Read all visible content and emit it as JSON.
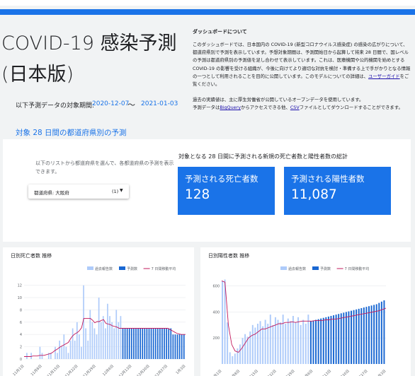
{
  "header": {
    "title": "COVID-19 感染予測 (日本版)",
    "period_label": "以下予測データの対象期間:",
    "period_start": "2020-12-07",
    "period_separator": "〜",
    "period_end": "2021-01-03"
  },
  "about": {
    "title": "ダッシュボードについて",
    "paragraph1_pre": "このダッシュボードでは、日本国内の COVID-19 (新型コロナウイルス感染症) の感染の広がりについて、都道府県別で予測を表示しています。予想対象期間は、予測開始日から起算して将来 28 日間で、国レベルの予測は都道府県別の予測値を足し合わせて表示しています。これは、医療機関や公的機関を始めとする COVID-19 の影響を受ける組織が、今後に向けてより適切な対抗を検討・準備する上で手がかりとなる情報の一つとして利用されることを目的に公開しています。このモデルについての詳細は、",
    "user_guide_link": "ユーザーガイド",
    "paragraph1_post": "をご覧ください。",
    "paragraph2_line1": "過去の実績値は、主に厚生労働省が公開しているオープンデータを使用しています。",
    "paragraph2_pre": "予測データは",
    "bigquery_link": "BigQuery",
    "paragraph2_mid": "からアクセスできる他、",
    "csv_link": "CSV",
    "paragraph2_post": "ファイルとしてダウンロードすることができます。"
  },
  "section": {
    "heading": "対象 28 日間の都道府県別の予測"
  },
  "selector": {
    "help_text": "以下のリストから都道府県を選んで、各都道府県の予測を表示できます。",
    "dropdown_label": "都道府県: 大阪府",
    "dropdown_count": "(1)"
  },
  "summary": {
    "heading": "対象となる 28 日間に予測される新規の死亡者数と陽性者数の総計",
    "deaths_label": "予測される死亡者数",
    "deaths_value": "128",
    "positives_label": "予測される陽性者数",
    "positives_value": "11,087"
  },
  "colors": {
    "accent": "#1a73e8",
    "reported_bar": "#aecbfa",
    "forecast_bar": "#1967d2",
    "moving_avg": "#c2185b"
  },
  "chart_data": [
    {
      "type": "bar",
      "title": "日別死亡者数 推移",
      "legend": [
        "過去報告数",
        "予測数",
        "7 日間移動平均"
      ],
      "y_ticks": [
        "0",
        "2",
        "4",
        "6",
        "8",
        "10",
        "12"
      ],
      "ylim": [
        0,
        13
      ],
      "x_labels": [
        "11月1日",
        "11月8日",
        "11月15日",
        "11月22日",
        "11月29日",
        "12月6日",
        "12月13日",
        "12月20日",
        "12月27日",
        "1月3日"
      ],
      "series": [
        {
          "name": "過去報告数",
          "values": [
            0,
            1,
            0,
            1,
            0,
            0,
            0,
            2,
            1,
            0,
            0,
            1,
            1,
            0,
            2,
            1,
            3,
            2,
            4,
            2,
            1,
            3,
            5,
            3,
            6,
            4,
            2,
            12,
            5,
            3,
            8,
            6,
            5,
            4,
            10,
            6,
            7,
            5,
            9,
            7,
            6,
            5,
            8,
            6,
            7
          ]
        },
        {
          "name": "予測数",
          "values": [
            5,
            5,
            5,
            5,
            5,
            5,
            5,
            5,
            5,
            5,
            5,
            5,
            5,
            5,
            5,
            5,
            5,
            5,
            5,
            5,
            5,
            5,
            5,
            4,
            4,
            4,
            4,
            4,
            4
          ]
        },
        {
          "name": "7 日間移動平均",
          "values": [
            0.4,
            0.4,
            0.4,
            0.4,
            0.5,
            0.5,
            0.5,
            0.6,
            0.6,
            0.6,
            0.7,
            0.8,
            0.9,
            1.1,
            1.4,
            1.6,
            1.9,
            2.1,
            2.3,
            2.5,
            2.7,
            3.3,
            3.8,
            4.1,
            4.3,
            4.6,
            5.1,
            6.6,
            6.6,
            6.6,
            6.6,
            6.3,
            5.9,
            6.1,
            6.1,
            6.3,
            6.4,
            5.8,
            5.7,
            5.6,
            5.4,
            5.3,
            5.2,
            5.0,
            5.0,
            5.0,
            5.0,
            5.0,
            5.0,
            5.0,
            5.0,
            5.0,
            5.0,
            5.0,
            5.0,
            5.0,
            5.0,
            5.0,
            5.0,
            5.0,
            5.0,
            5.0,
            5.0,
            5.0,
            5.0,
            5.0,
            4.8,
            4.6,
            4.4,
            4.2,
            4.1,
            4.0,
            4.0,
            4.0
          ]
        }
      ]
    },
    {
      "type": "bar",
      "title": "日別陽性者数 推移",
      "legend": [
        "過去報告数",
        "予測数",
        "7 日間移動平均"
      ],
      "y_ticks": [
        "200",
        "400",
        "600"
      ],
      "ylim": [
        0,
        680
      ],
      "x_labels": [
        "11月1日",
        "11月8日",
        "11月15日",
        "11月22日",
        "11月29日",
        "12月6日",
        "12月13日",
        "12月20日",
        "12月27日",
        "1月3日"
      ],
      "series": [
        {
          "name": "過去報告数",
          "values": [
            640,
            650,
            320,
            90,
            60,
            80,
            120,
            150,
            200,
            230,
            210,
            250,
            300,
            280,
            310,
            330,
            290,
            340,
            310,
            380,
            300,
            360,
            340,
            320,
            380,
            310,
            350,
            330,
            370,
            320,
            360,
            300,
            340,
            310,
            380
          ]
        },
        {
          "name": "予測数",
          "values": [
            330,
            335,
            340,
            345,
            350,
            355,
            360,
            365,
            370,
            375,
            380,
            385,
            390,
            395,
            400,
            405,
            410,
            415,
            420,
            425,
            430,
            435,
            440,
            445,
            450,
            455,
            460,
            470,
            480,
            490
          ]
        },
        {
          "name": "7 日間移動平均",
          "values": [
            640,
            630,
            300,
            150,
            100,
            90,
            120,
            160,
            200,
            220,
            230,
            250,
            270,
            270,
            280,
            290,
            300,
            310,
            310,
            320,
            320,
            325,
            320,
            325,
            330,
            330,
            330,
            330,
            335,
            335,
            335,
            340,
            340,
            345,
            345,
            350,
            355,
            360,
            365,
            370,
            375,
            380,
            385,
            390,
            395,
            400,
            405,
            410,
            420,
            430
          ]
        }
      ]
    }
  ]
}
